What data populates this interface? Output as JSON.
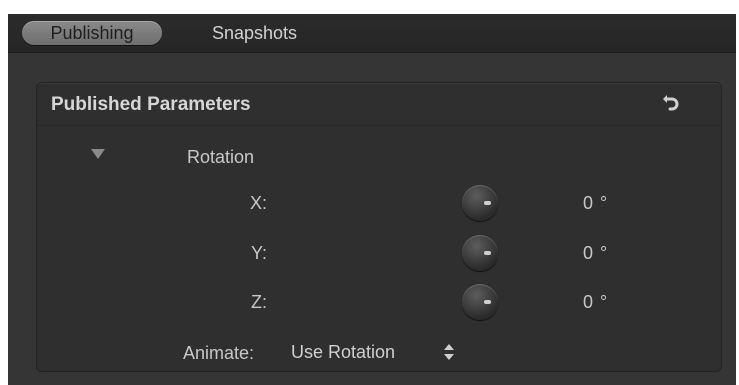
{
  "tabs": [
    {
      "label": "Publishing",
      "active": true
    },
    {
      "label": "Snapshots",
      "active": false
    }
  ],
  "panel": {
    "title": "Published Parameters",
    "reset_icon": "reset-arrow-icon"
  },
  "group": {
    "label": "Rotation",
    "expanded": true,
    "disclosure_icon": "disclosure-triangle-icon"
  },
  "params": [
    {
      "axis": "X:",
      "value": "0 °"
    },
    {
      "axis": "Y:",
      "value": "0 °"
    },
    {
      "axis": "Z:",
      "value": "0 °"
    }
  ],
  "animate": {
    "label": "Animate:",
    "value": "Use Rotation",
    "icon": "up-down-arrows-icon"
  },
  "colors": {
    "window_bg": "#353535",
    "panel_bg": "#2f2f2f",
    "text": "#c8c8c8",
    "active_tab": "#7c7c7c"
  }
}
